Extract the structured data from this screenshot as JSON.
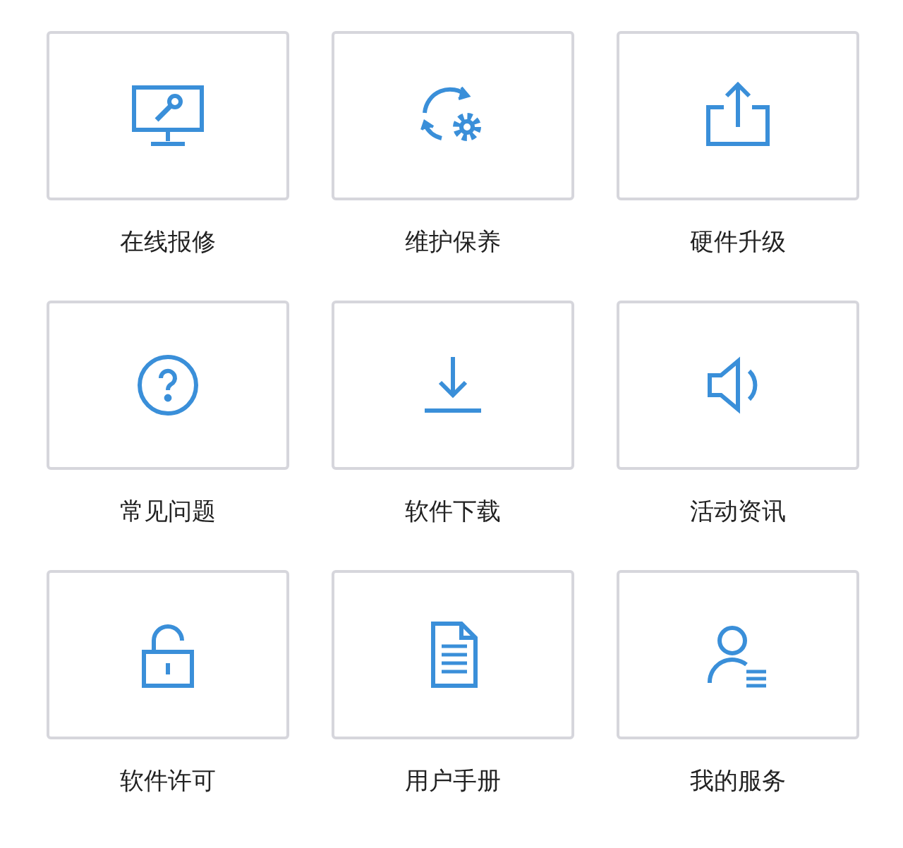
{
  "services": [
    {
      "label": "在线报修"
    },
    {
      "label": "维护保养"
    },
    {
      "label": "硬件升级"
    },
    {
      "label": "常见问题"
    },
    {
      "label": "软件下载"
    },
    {
      "label": "活动资讯"
    },
    {
      "label": "软件许可"
    },
    {
      "label": "用户手册"
    },
    {
      "label": "我的服务"
    }
  ]
}
